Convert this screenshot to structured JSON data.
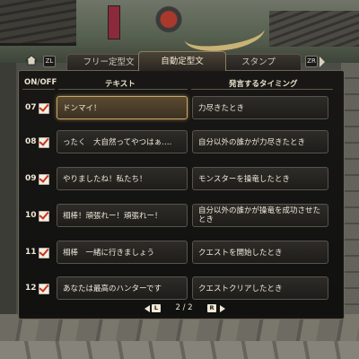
{
  "tabs": {
    "left_key": "ZL",
    "right_key": "ZR",
    "items": [
      {
        "label": "フリー定型文"
      },
      {
        "label": "自動定型文"
      },
      {
        "label": "スタンプ"
      }
    ],
    "active": 1
  },
  "headers": {
    "onoff": "ON/OFF",
    "text": "テキスト",
    "timing": "発言するタイミング"
  },
  "rows": [
    {
      "num": "07",
      "checked": true,
      "text": "ドンマイ！",
      "timing": "力尽きたとき",
      "selected": true
    },
    {
      "num": "08",
      "checked": true,
      "text": "ったく　大自然ってやつはぁ….",
      "timing": "自分以外の誰かが力尽きたとき"
    },
    {
      "num": "09",
      "checked": true,
      "text": "やりましたね！私たち！",
      "timing": "モンスターを操竜したとき"
    },
    {
      "num": "10",
      "checked": true,
      "text": "相棒！頑張れー！頑張れー！",
      "timing": "自分以外の誰かが操竜を成功させたとき"
    },
    {
      "num": "11",
      "checked": true,
      "text": "相棒　一緒に行きましょう",
      "timing": "クエストを開始したとき"
    },
    {
      "num": "12",
      "checked": true,
      "text": "あなたは最高のハンターです",
      "timing": "クエストクリアしたとき"
    }
  ],
  "pager": {
    "left_key": "L",
    "right_key": "R",
    "current": "2",
    "total": "2",
    "text": "2 / 2"
  },
  "colors": {
    "accent_selected": "#c7a96a",
    "check_mark": "#c8331f"
  }
}
